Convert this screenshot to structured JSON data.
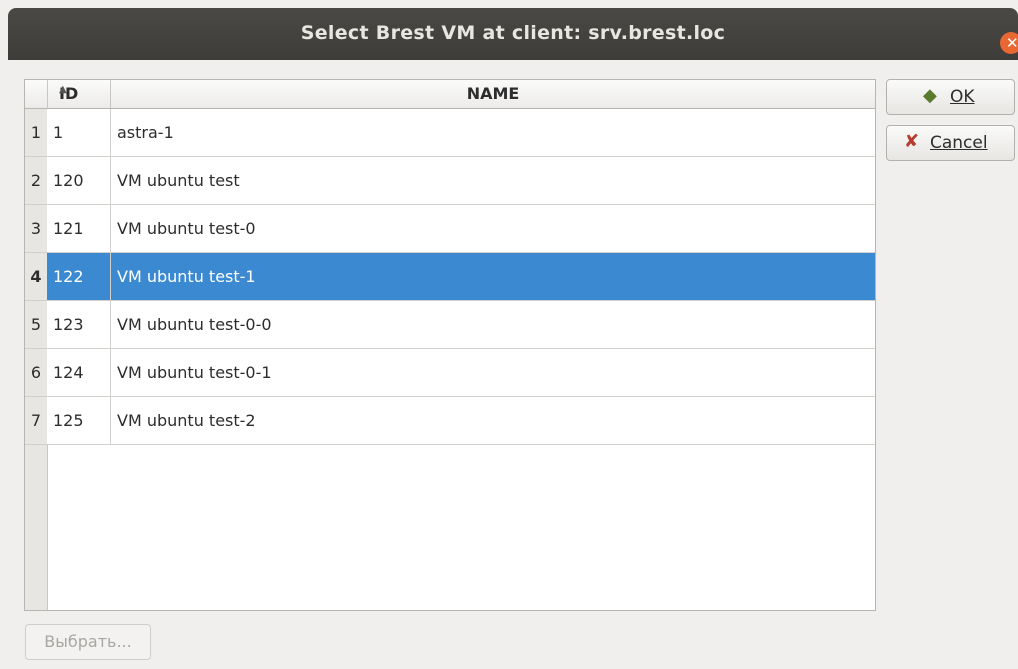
{
  "window": {
    "title": "Select Brest VM at client: srv.brest.loc"
  },
  "table": {
    "columns": {
      "id": "ID",
      "name": "NAME"
    },
    "rows": [
      {
        "num": "1",
        "id": "1",
        "name": "astra-1"
      },
      {
        "num": "2",
        "id": "120",
        "name": "VM ubuntu test"
      },
      {
        "num": "3",
        "id": "121",
        "name": "VM ubuntu test-0"
      },
      {
        "num": "4",
        "id": "122",
        "name": "VM ubuntu test-1"
      },
      {
        "num": "5",
        "id": "123",
        "name": "VM ubuntu test-0-0"
      },
      {
        "num": "6",
        "id": "124",
        "name": "VM ubuntu test-0-1"
      },
      {
        "num": "7",
        "id": "125",
        "name": "VM ubuntu test-2"
      }
    ],
    "selected_row": "4",
    "sort": {
      "column": "ID",
      "direction": "ascending"
    }
  },
  "buttons": {
    "ok": {
      "label": "OK",
      "icon": "check-icon"
    },
    "cancel": {
      "label": "Cancel",
      "icon": "x-icon"
    },
    "pick": {
      "label": "Выбрать...",
      "enabled": false
    }
  },
  "colors": {
    "selection": "#3b8ad1",
    "titlebar": "#3d3c39",
    "close": "#e86733"
  }
}
